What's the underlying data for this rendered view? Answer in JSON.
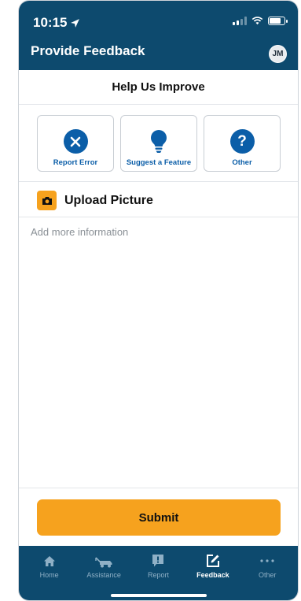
{
  "status_bar": {
    "time": "10:15"
  },
  "header": {
    "title": "Provide Feedback",
    "avatar_initials": "JM"
  },
  "section": {
    "title": "Help Us Improve"
  },
  "options": [
    {
      "label": "Report Error",
      "icon": "close-circle-icon"
    },
    {
      "label": "Suggest a Feature",
      "icon": "lightbulb-icon"
    },
    {
      "label": "Other",
      "icon": "question-circle-icon"
    }
  ],
  "upload": {
    "label": "Upload Picture",
    "icon": "camera-icon"
  },
  "info": {
    "placeholder": "Add more information",
    "value": ""
  },
  "submit": {
    "label": "Submit"
  },
  "tabs": [
    {
      "label": "Home",
      "icon": "home-icon"
    },
    {
      "label": "Assistance",
      "icon": "tow-truck-icon"
    },
    {
      "label": "Report",
      "icon": "report-icon"
    },
    {
      "label": "Feedback",
      "icon": "edit-icon",
      "active": true
    },
    {
      "label": "Other",
      "icon": "more-icon"
    }
  ],
  "colors": {
    "brand": "#0d4a6e",
    "accent": "#f6a21e",
    "link": "#0b5ea8"
  }
}
